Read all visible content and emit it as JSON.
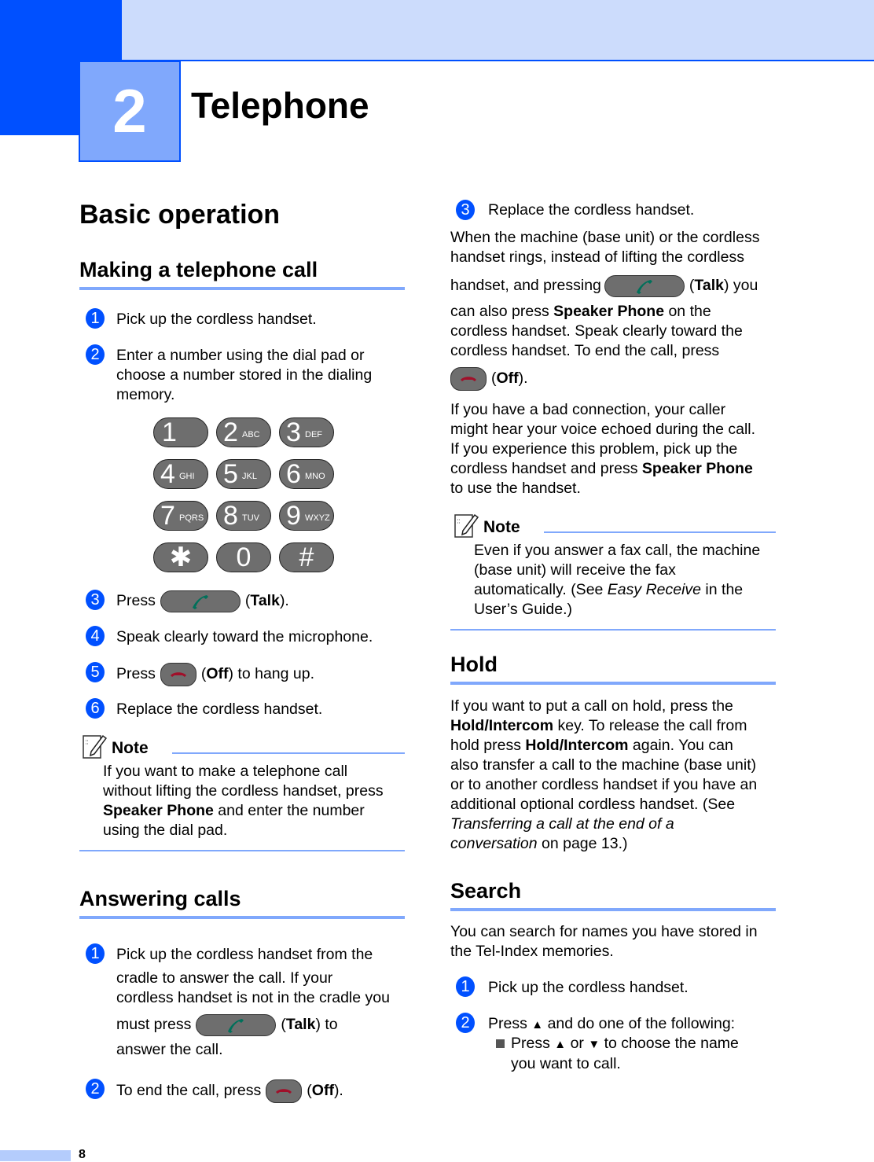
{
  "chapter": {
    "number": "2",
    "title": "Telephone"
  },
  "section_title": "Basic operation",
  "making_call": {
    "heading": "Making a telephone call",
    "steps": [
      {
        "n": "1",
        "text": "Pick up the cordless handset."
      },
      {
        "n": "2",
        "text": "Enter a number using the dial pad or choose a number stored in the dialing memory."
      },
      {
        "n": "3",
        "pre": "Press",
        "post_bold": "Talk",
        "post": ")."
      },
      {
        "n": "4",
        "text": "Speak clearly toward the microphone."
      },
      {
        "n": "5",
        "pre": "Press",
        "post_bold": "Off",
        "post": ") to hang up."
      },
      {
        "n": "6",
        "text": "Replace the cordless handset."
      }
    ],
    "keypad": [
      {
        "digit": "1",
        "letters": ""
      },
      {
        "digit": "2",
        "letters": "ABC"
      },
      {
        "digit": "3",
        "letters": "DEF"
      },
      {
        "digit": "4",
        "letters": "GHI"
      },
      {
        "digit": "5",
        "letters": "JKL"
      },
      {
        "digit": "6",
        "letters": "MNO"
      },
      {
        "digit": "7",
        "letters": "PQRS"
      },
      {
        "digit": "8",
        "letters": "TUV"
      },
      {
        "digit": "9",
        "letters": "WXYZ"
      },
      {
        "digit": "✱",
        "letters": ""
      },
      {
        "digit": "0",
        "letters": ""
      },
      {
        "digit": "#",
        "letters": ""
      }
    ],
    "note": {
      "label": "Note",
      "line1": "If you want to make a telephone call",
      "line2": "without lifting the cordless handset, press",
      "bold": "Speaker Phone",
      "line3_rest": " and enter the number",
      "line4": "using the dial pad."
    }
  },
  "answering": {
    "heading": "Answering calls",
    "step1": {
      "n": "1",
      "line1": "Pick up the cordless handset from the",
      "line2": "cradle to answer the call. If your",
      "line3": "cordless handset is not in the cradle you",
      "line4_pre": "must press",
      "line4_bold": "Talk",
      "line4_post": ") to",
      "line5": "answer the call."
    },
    "step2": {
      "n": "2",
      "pre": "To end the call, press",
      "bold": "Off",
      "post": ")."
    },
    "step3": {
      "n": "3",
      "text": "Replace the cordless handset."
    },
    "para1": {
      "line1": "When the machine (base unit) or the cordless",
      "line2": "handset rings, instead of lifting the cordless",
      "line3_pre": "handset, and pressing",
      "line3_bold": "Talk",
      "line3_post": ") you",
      "line4_pre": "can also press ",
      "line4_bold": "Speaker Phone",
      "line4_post": " on the",
      "line5": "cordless handset. Speak clearly toward the",
      "line6": "cordless handset. To end the call, press",
      "line7_bold": "Off",
      "line7_post": ")."
    },
    "para2": {
      "line1": "If you have a bad connection, your caller",
      "line2": "might hear your voice echoed during the call.",
      "line3": "If you experience this problem, pick up the",
      "line4_pre": "cordless handset and press ",
      "line4_bold": "Speaker Phone",
      "line5": "to use the handset."
    },
    "note": {
      "label": "Note",
      "line1": "Even if you answer a fax call, the machine",
      "line2": "(base unit) will receive the fax",
      "line3_pre": "automatically. (See ",
      "line3_italic": "Easy Receive",
      "line3_post": " in the",
      "line4": "User’s Guide.)"
    }
  },
  "hold": {
    "heading": "Hold",
    "line1": "If you want to put a call on hold, press the",
    "line2_bold": "Hold/Intercom",
    "line2_post": " key. To release the call from",
    "line3_pre": "hold press ",
    "line3_bold": "Hold/Intercom",
    "line3_post": " again. You can",
    "line4": "also transfer a call to the machine (base unit)",
    "line5": "or to another cordless handset if you have an",
    "line6": "additional optional cordless handset. (See",
    "line7_italic": "Transferring a call at the end of a",
    "line8_italic": "conversation",
    "line8_post": " on page 13.)"
  },
  "search": {
    "heading": "Search",
    "intro1": "You can search for names you have stored in",
    "intro2": "the Tel-Index memories.",
    "step1": {
      "n": "1",
      "text": "Pick up the cordless handset."
    },
    "step2": {
      "n": "2",
      "pre": "Press",
      "arrow_up": "▲",
      "post": "and do one of the following:"
    },
    "bullet": {
      "pre": "Press",
      "up": "▲",
      "or": "or",
      "down": "▼",
      "post": "to choose the name",
      "line2": "you want to call."
    }
  },
  "page_number": "8",
  "colors": {
    "brand_dark": "#0050ff",
    "brand_light": "#ccdcfc",
    "rule": "#80a8fc",
    "talk_icon": "#00705a",
    "off_icon": "#a0102a"
  }
}
